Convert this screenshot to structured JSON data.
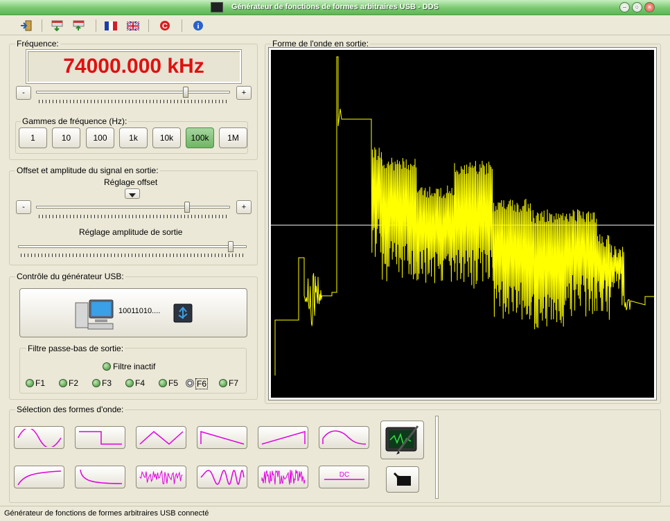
{
  "window": {
    "title": "Générateur de fonctions de formes arbitraires USB - DDS"
  },
  "frequency": {
    "group_title": "Fréquence:",
    "display": "74000.000 kHz",
    "minus": "-",
    "plus": "+",
    "slider_position": 0.77,
    "ranges_title": "Gammes de fréquence (Hz):",
    "ranges": [
      "1",
      "10",
      "100",
      "1k",
      "10k",
      "100k",
      "1M"
    ],
    "selected_range": "100k"
  },
  "offset": {
    "group_title": "Offset et amplitude du signal en sortie:",
    "offset_label": "Réglage offset",
    "minus": "-",
    "plus": "+",
    "offset_position": 0.78,
    "amplitude_label": "Réglage amplitude de sortie",
    "amplitude_position": 0.93
  },
  "usb": {
    "group_title": "Contrôle du générateur USB:",
    "bits": "10011010....",
    "filter_title": "Filtre passe-bas de sortie:",
    "filter_inactive": "Filtre inactif",
    "filters": [
      "F1",
      "F2",
      "F3",
      "F4",
      "F5",
      "F6",
      "F7"
    ],
    "selected_filter": "F6"
  },
  "scope": {
    "group_title": "Forme de l'onde en sortie:",
    "trace_color": "#ffff00"
  },
  "waveforms": {
    "group_title": "Sélection des formes d'onde:",
    "dc_label": "DC",
    "accent": "#e000e0"
  },
  "status": {
    "text": "Générateur de fonctions de formes arbitraires USB connecté"
  }
}
